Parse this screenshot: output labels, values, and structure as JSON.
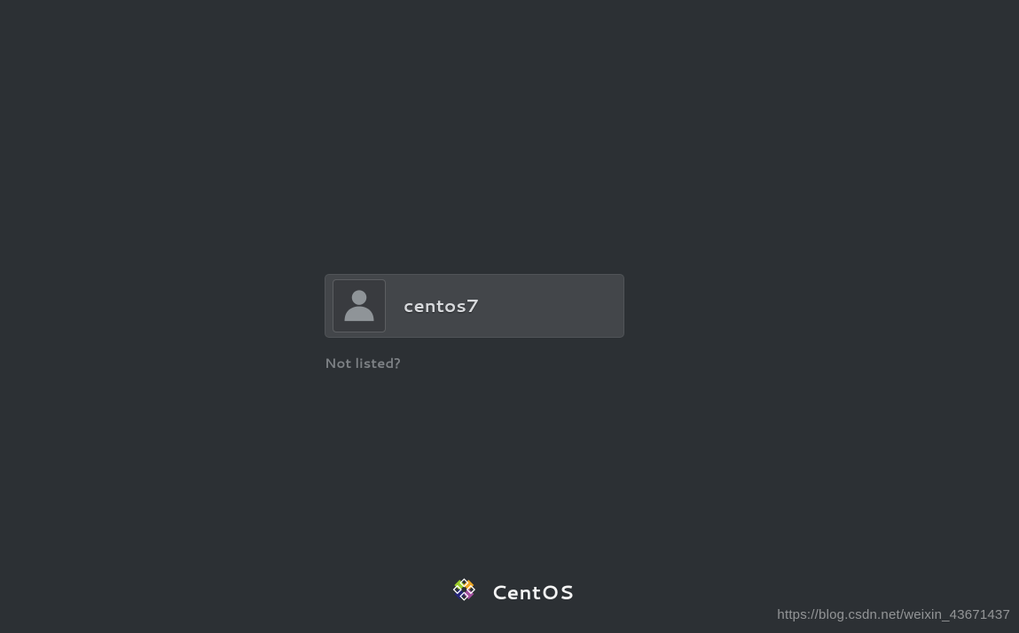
{
  "login": {
    "users": [
      {
        "name": "centos7"
      }
    ],
    "not_listed_label": "Not listed?"
  },
  "brand": {
    "name": "CentOS"
  },
  "watermark": "https://blog.csdn.net/weixin_43671437"
}
